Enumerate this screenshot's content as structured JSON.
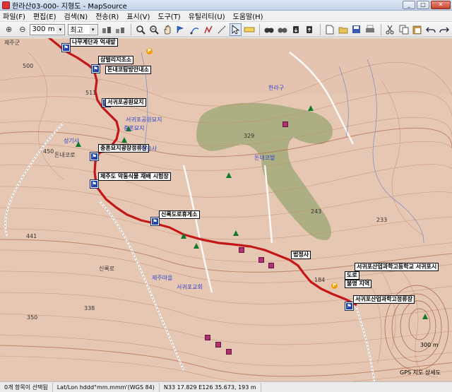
{
  "window": {
    "title": "한라산03-000- 지형도 - MapSource",
    "min": "_",
    "max": "□",
    "close": "✕"
  },
  "menu": [
    "파일(F)",
    "편집(E)",
    "검색(N)",
    "전송(R)",
    "표시(V)",
    "도구(T)",
    "유틸리티(U)",
    "도움말(H)"
  ],
  "toolbar": {
    "zoom_in": "⊕",
    "zoom_out": "⊖",
    "scale_value": "300 m",
    "detail_value": "최고",
    "arrow": "▾"
  },
  "map": {
    "waypoints": [
      {
        "label": "나무계단과 억새밭"
      },
      {
        "label": "삼벌리지조소"
      },
      {
        "label": "돈내코탐방안내소"
      },
      {
        "label": "서귀포공원묘지"
      },
      {
        "label": "충혼묘지광장정류장"
      },
      {
        "label": "제주도 악동식물 재배 시험장"
      },
      {
        "label": "신록도로휴게소"
      },
      {
        "label": "법정사"
      },
      {
        "label": "서귀포산업과학고등학교 서귀포시"
      },
      {
        "label": "도로"
      },
      {
        "label": "불명 지역"
      },
      {
        "label": "서귀포산업과학고정류장"
      }
    ],
    "labels": {
      "jeju_gun": "제주군",
      "n500": "500",
      "n511": "511",
      "n450": "450",
      "n441": "441",
      "n329": "329",
      "n338": "338",
      "n350": "350",
      "n233": "233",
      "n243": "243",
      "n184": "184",
      "donnaekoro": "돈내코로",
      "sinrokro": "신록로",
      "seogwipo_cemetery": "서귀포공원묘지",
      "seongisa": "성기사",
      "hyeonchungsa": "현충사",
      "chunghonmyoji": "충혼묘지",
      "jeju_maeul": "제주마을",
      "seogwipo_gyohoe": "서귀포교회",
      "hanragu": "한라구",
      "donnaeko_field": "돈내코밭"
    },
    "scale_text": "300 m",
    "gps_text": "GPS 지도 상세도"
  },
  "status": {
    "selection": "0개 항목이 선택됨",
    "coord_format": "Lat/Lon hddd°mm.mmm'(WGS 84)",
    "coords": "N33 17.829 E126 35.673, 193 m"
  }
}
